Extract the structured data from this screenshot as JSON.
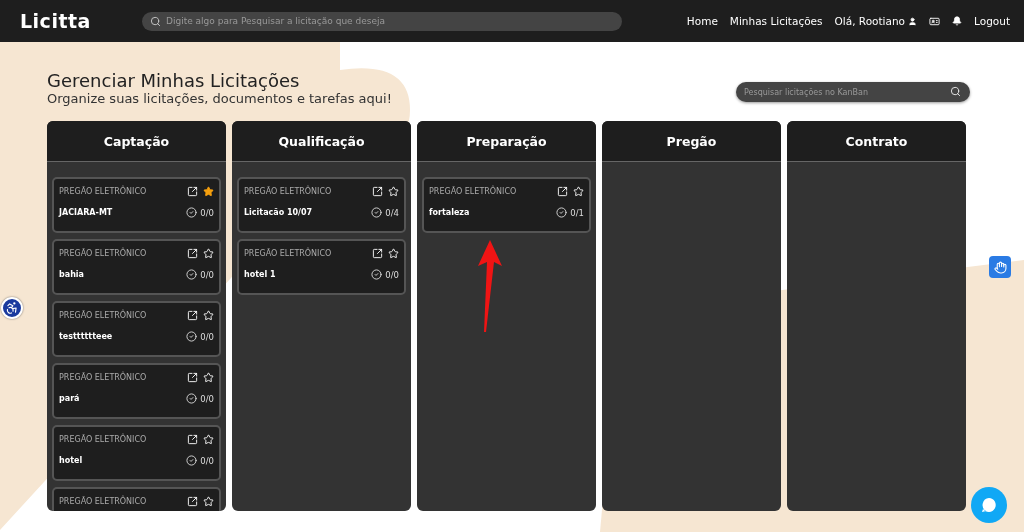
{
  "navbar": {
    "logo": "Licitta",
    "search": {
      "placeholder": "Digite algo para Pesquisar a licitação que deseja"
    },
    "links": [
      "Home",
      "Minhas Licitações"
    ],
    "user": "Olá, Rootiano",
    "logout": "Logout"
  },
  "header": {
    "title": "Gerenciar Minhas Licitações",
    "subtitle": "Organize suas licitações, documentos e tarefas aqui!"
  },
  "kanban_search": {
    "placeholder": "Pesquisar licitações no KanBan"
  },
  "columns": [
    {
      "title": "Captação",
      "cards": [
        {
          "type": "PREGÃO ELETRÔNICO",
          "name": "JACIARA-MT",
          "tasks": "0/0",
          "starred": true
        },
        {
          "type": "PREGÃO ELETRÔNICO",
          "name": "bahia",
          "tasks": "0/0",
          "starred": false
        },
        {
          "type": "PREGÃO ELETRÔNICO",
          "name": "testttttteee",
          "tasks": "0/0",
          "starred": false
        },
        {
          "type": "PREGÃO ELETRÔNICO",
          "name": "pará",
          "tasks": "0/0",
          "starred": false
        },
        {
          "type": "PREGÃO ELETRÔNICO",
          "name": "hotel",
          "tasks": "0/0",
          "starred": false
        },
        {
          "type": "PREGÃO ELETRÔNICO",
          "starred": false
        }
      ]
    },
    {
      "title": "Qualificação",
      "cards": [
        {
          "type": "PREGÃO ELETRÔNICO",
          "name": "Licitacão 10/07",
          "tasks": "0/4",
          "starred": false
        },
        {
          "type": "PREGÃO ELETRÔNICO",
          "name": "hotel 1",
          "tasks": "0/0",
          "starred": false
        }
      ]
    },
    {
      "title": "Preparação",
      "cards": [
        {
          "type": "PREGÃO ELETRÔNICO",
          "name": "fortaleza",
          "tasks": "0/1",
          "starred": false
        }
      ]
    },
    {
      "title": "Pregão"
    },
    {
      "title": "Contrato"
    }
  ]
}
